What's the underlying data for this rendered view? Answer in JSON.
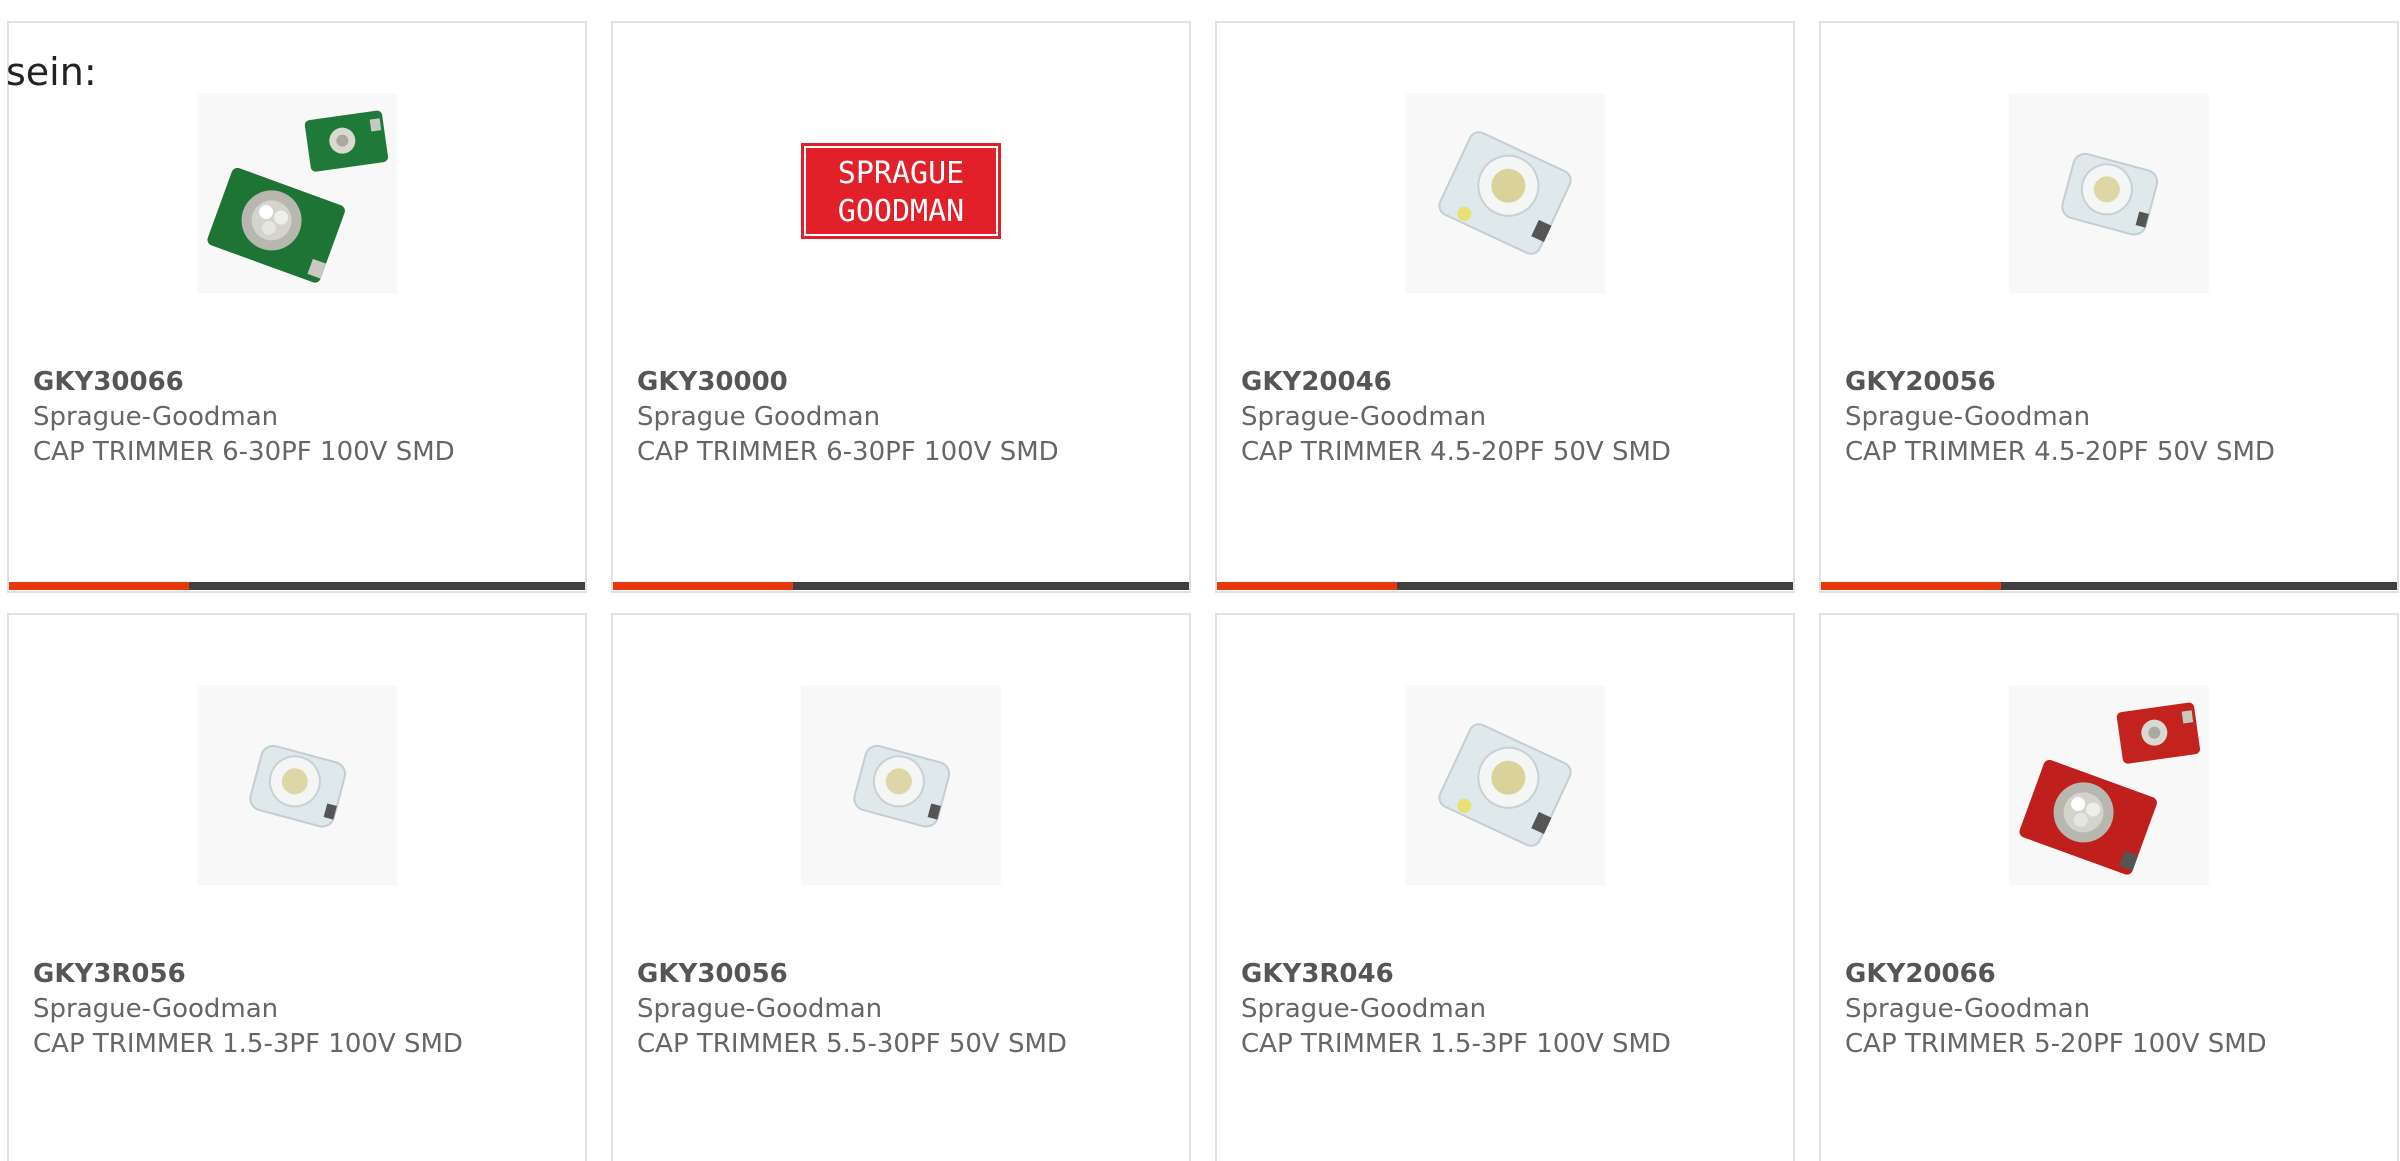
{
  "intro_text": "sein:",
  "colors": {
    "accent": "#e8380d",
    "bar_dark": "#404040",
    "logo_red": "#e2202a"
  },
  "products": [
    {
      "part": "GKY30066",
      "maker": "Sprague-Goodman",
      "desc": "CAP TRIMMER 6-30PF 100V SMD",
      "image": "green-trimmer-icon"
    },
    {
      "part": "GKY30000",
      "maker": "Sprague Goodman",
      "desc": "CAP TRIMMER 6-30PF 100V SMD",
      "image": "sprague-goodman-logo",
      "logo_text": [
        "SPRAGUE",
        "GOODMAN"
      ]
    },
    {
      "part": "GKY20046",
      "maker": "Sprague-Goodman",
      "desc": "CAP TRIMMER 4.5-20PF 50V SMD",
      "image": "white-trimmer-icon"
    },
    {
      "part": "GKY20056",
      "maker": "Sprague-Goodman",
      "desc": "CAP TRIMMER 4.5-20PF 50V SMD",
      "image": "white-trimmer-small-icon"
    },
    {
      "part": "GKY3R056",
      "maker": "Sprague-Goodman",
      "desc": "CAP TRIMMER 1.5-3PF 100V SMD",
      "image": "white-trimmer-small-icon"
    },
    {
      "part": "GKY30056",
      "maker": "Sprague-Goodman",
      "desc": "CAP TRIMMER 5.5-30PF 50V SMD",
      "image": "white-trimmer-small-icon"
    },
    {
      "part": "GKY3R046",
      "maker": "Sprague-Goodman",
      "desc": "CAP TRIMMER 1.5-3PF 100V SMD",
      "image": "white-trimmer-icon"
    },
    {
      "part": "GKY20066",
      "maker": "Sprague-Goodman",
      "desc": "CAP TRIMMER 5-20PF 100V SMD",
      "image": "red-trimmer-icon"
    }
  ]
}
